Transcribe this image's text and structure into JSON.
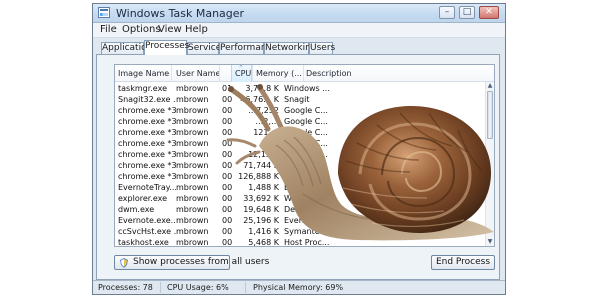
{
  "window": {
    "title": "Windows Task Manager",
    "controls": [
      "–",
      "□",
      "✕"
    ]
  },
  "menu": {
    "file": "File",
    "options": "Options",
    "view": "View",
    "help": "Help"
  },
  "tabs": [
    "Applications",
    "Processes",
    "Services",
    "Performance",
    "Networking",
    "Users"
  ],
  "table": {
    "columns": {
      "image": "Image Name",
      "user": "User Name",
      "cpu": "CPU",
      "memory": "Memory (...",
      "description": "Description"
    },
    "rows": [
      {
        "image": "taskmgr.exe",
        "user": "mbrown",
        "cpu": "01",
        "memory": "3,7…8 K",
        "description": "Windows ..."
      },
      {
        "image": "Snagit32.exe ...",
        "user": "mbrown",
        "cpu": "00",
        "memory": "46,76… K",
        "description": "Snagit"
      },
      {
        "image": "chrome.exe *32",
        "user": "mbrown",
        "cpu": "00",
        "memory": "…7,252",
        "description": "Google C..."
      },
      {
        "image": "chrome.exe *32",
        "user": "mbrown",
        "cpu": "00",
        "memory": "…2,…",
        "description": "Google C..."
      },
      {
        "image": "chrome.exe *32",
        "user": "mbrown",
        "cpu": "00",
        "memory": "121,…",
        "description": "Google C..."
      },
      {
        "image": "chrome.exe *32",
        "user": "mbrown",
        "cpu": "00",
        "memory": "…",
        "description": "Google C..."
      },
      {
        "image": "chrome.exe *32",
        "user": "mbrown",
        "cpu": "00",
        "memory": "12,13…",
        "description": "Google C..."
      },
      {
        "image": "chrome.exe *32",
        "user": "mbrown",
        "cpu": "00",
        "memory": "71,744 K",
        "description": "Google C..."
      },
      {
        "image": "chrome.exe *32",
        "user": "mbrown",
        "cpu": "00",
        "memory": "126,888 K",
        "description": "Google C..."
      },
      {
        "image": "EvernoteTray...",
        "user": "mbrown",
        "cpu": "00",
        "memory": "1,488 K",
        "description": "Eve..."
      },
      {
        "image": "explorer.exe",
        "user": "mbrown",
        "cpu": "00",
        "memory": "33,692 K",
        "description": "Wind..."
      },
      {
        "image": "dwm.exe",
        "user": "mbrown",
        "cpu": "00",
        "memory": "19,648 K",
        "description": "Deskt..."
      },
      {
        "image": "Evernote.exe...",
        "user": "mbrown",
        "cpu": "00",
        "memory": "25,196 K",
        "description": "Evernote..."
      },
      {
        "image": "ccSvcHst.exe ...",
        "user": "mbrown",
        "cpu": "00",
        "memory": "1,416 K",
        "description": "Symante..."
      },
      {
        "image": "taskhost.exe",
        "user": "mbrown",
        "cpu": "00",
        "memory": "5,468 K",
        "description": "Host Proc..."
      }
    ]
  },
  "buttons": {
    "show_processes": "Show processes from all users",
    "end_process": "End Process"
  },
  "status": {
    "processes": "Processes: 78",
    "cpu_usage": "CPU Usage: 6%",
    "physical_memory": "Physical Memory: 69%"
  },
  "colors": {
    "window_frame": "#dfe8f1",
    "title_bar": "#c4daf0",
    "selection_column": "#d8efff",
    "snail_shell": "#7a4a27"
  },
  "icons": {
    "app": "task-manager-icon",
    "shield": "shield-icon",
    "overlay": "snail-illustration"
  }
}
